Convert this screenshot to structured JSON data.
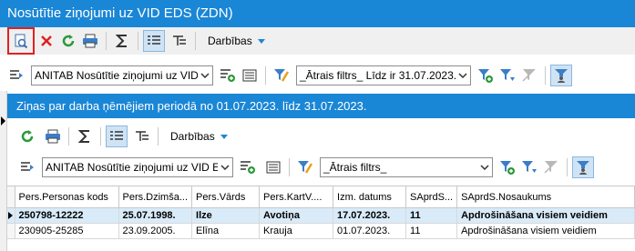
{
  "window": {
    "title": "Nosūtītie ziņojumi uz VID EDS (ZDN)"
  },
  "outer": {
    "actions_label": "Darbības",
    "report_select": "ANITAB Nosūtītie ziņojumi uz VID EDS",
    "filter_select": "_Ātrais filtrs_ Līdz ir 31.07.2023."
  },
  "inner": {
    "title": "Ziņas par darba ņēmējiem periodā no 01.07.2023. līdz 31.07.2023.",
    "actions_label": "Darbības",
    "report_select": "ANITAB Nosūtītie ziņojumi uz VID EDS",
    "filter_select": "_Ātrais filtrs_"
  },
  "table": {
    "columns": [
      "Pers.Personas kods",
      "Pers.Dzimša...",
      "Pers.Vārds",
      "Pers.KartV....",
      "Izm. datums",
      "SAprdS...",
      "SAprdS.Nosaukums"
    ],
    "rows": [
      [
        "250798-12222",
        "25.07.1998.",
        "Ilze",
        "Avotiņa",
        "17.07.2023.",
        "11",
        "Apdrošināšana visiem veidiem"
      ],
      [
        "230905-25285",
        "23.09.2005.",
        "Elīna",
        "Krauja",
        "01.07.2023.",
        "11",
        "Apdrošināšana visiem veidiem"
      ]
    ],
    "selected_row": 0
  },
  "colors": {
    "accent": "#1a86d6",
    "highlight": "#e02020",
    "selected_row": "#d9ebf9"
  }
}
